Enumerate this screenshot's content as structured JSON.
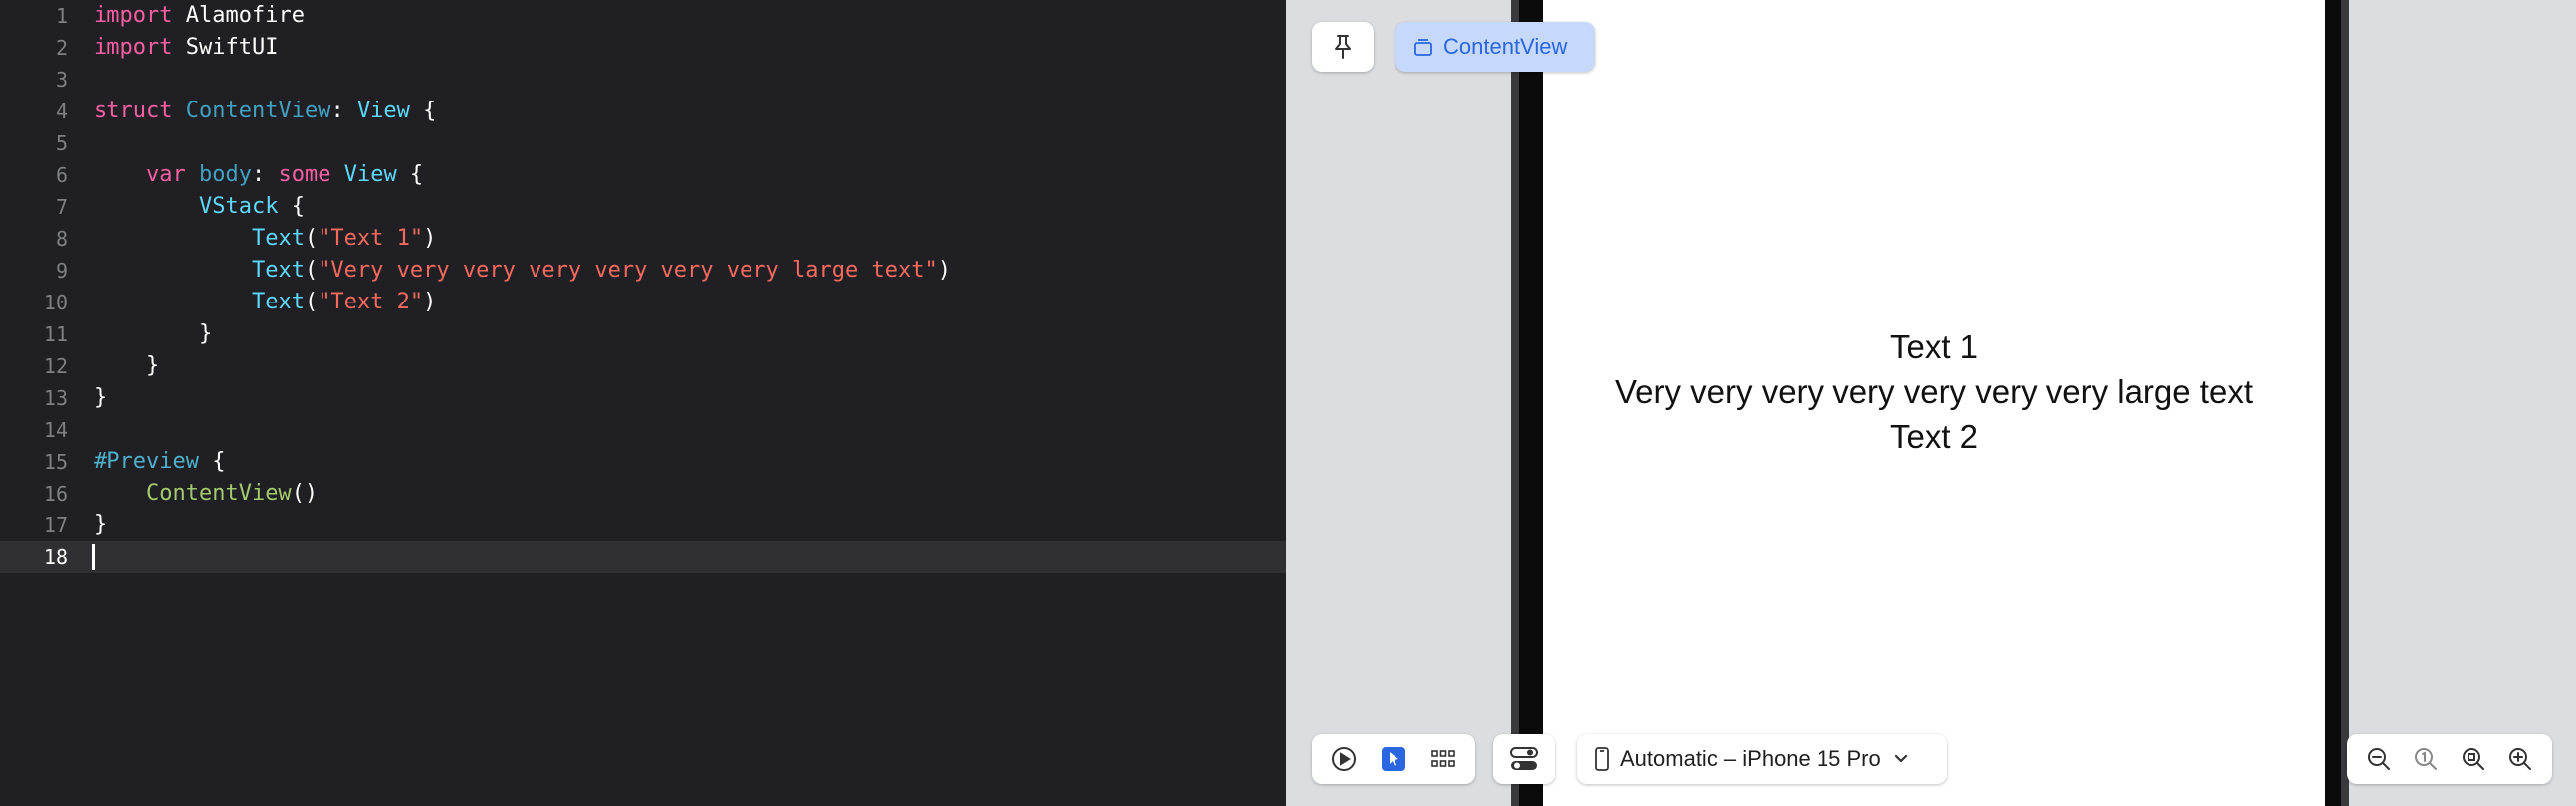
{
  "editor": {
    "current_line": 18,
    "lines": [
      {
        "n": "1",
        "tokens": [
          [
            "kw",
            "import"
          ],
          [
            "plain",
            " Alamofire"
          ]
        ]
      },
      {
        "n": "2",
        "tokens": [
          [
            "kw",
            "import"
          ],
          [
            "plain",
            " SwiftUI"
          ]
        ]
      },
      {
        "n": "3",
        "tokens": []
      },
      {
        "n": "4",
        "tokens": [
          [
            "kw",
            "struct"
          ],
          [
            "plain",
            " "
          ],
          [
            "decl",
            "ContentView"
          ],
          [
            "plain",
            ": "
          ],
          [
            "type",
            "View"
          ],
          [
            "plain",
            " {"
          ]
        ]
      },
      {
        "n": "5",
        "tokens": []
      },
      {
        "n": "6",
        "tokens": [
          [
            "plain",
            "    "
          ],
          [
            "kw",
            "var"
          ],
          [
            "plain",
            " "
          ],
          [
            "decl",
            "body"
          ],
          [
            "plain",
            ": "
          ],
          [
            "kw",
            "some"
          ],
          [
            "plain",
            " "
          ],
          [
            "type",
            "View"
          ],
          [
            "plain",
            " {"
          ]
        ]
      },
      {
        "n": "7",
        "tokens": [
          [
            "plain",
            "        "
          ],
          [
            "type",
            "VStack"
          ],
          [
            "plain",
            " {"
          ]
        ]
      },
      {
        "n": "8",
        "tokens": [
          [
            "plain",
            "            "
          ],
          [
            "type",
            "Text"
          ],
          [
            "plain",
            "("
          ],
          [
            "str",
            "\"Text 1\""
          ],
          [
            "plain",
            ")"
          ]
        ]
      },
      {
        "n": "9",
        "tokens": [
          [
            "plain",
            "            "
          ],
          [
            "type",
            "Text"
          ],
          [
            "plain",
            "("
          ],
          [
            "str",
            "\"Very very very very very very very large text\""
          ],
          [
            "plain",
            ")"
          ]
        ]
      },
      {
        "n": "10",
        "tokens": [
          [
            "plain",
            "            "
          ],
          [
            "type",
            "Text"
          ],
          [
            "plain",
            "("
          ],
          [
            "str",
            "\"Text 2\""
          ],
          [
            "plain",
            ")"
          ]
        ]
      },
      {
        "n": "11",
        "tokens": [
          [
            "plain",
            "        }"
          ]
        ]
      },
      {
        "n": "12",
        "tokens": [
          [
            "plain",
            "    }"
          ]
        ]
      },
      {
        "n": "13",
        "tokens": [
          [
            "plain",
            "}"
          ]
        ]
      },
      {
        "n": "14",
        "tokens": []
      },
      {
        "n": "15",
        "tokens": [
          [
            "macro",
            "#Preview"
          ],
          [
            "plain",
            " {"
          ]
        ]
      },
      {
        "n": "16",
        "tokens": [
          [
            "plain",
            "    "
          ],
          [
            "usr",
            "ContentView"
          ],
          [
            "plain",
            "()"
          ]
        ]
      },
      {
        "n": "17",
        "tokens": [
          [
            "plain",
            "}"
          ]
        ]
      },
      {
        "n": "18",
        "tokens": []
      }
    ]
  },
  "canvas": {
    "view_chip_label": "ContentView",
    "preview_lines": [
      "Text 1",
      "Very very very very very very very large text",
      "Text 2"
    ],
    "device_label": "Automatic – iPhone 15 Pro",
    "icons": {
      "pin": "pin-icon",
      "view": "view-stack-icon",
      "live": "play-icon",
      "selectable": "cursor-icon",
      "variants": "grid-icon",
      "settings": "device-settings-icon",
      "device": "iphone-icon",
      "chevron": "chevron-down-icon",
      "zoom_out": "zoom-out-icon",
      "zoom_100": "zoom-100-icon",
      "zoom_fit": "zoom-fit-icon",
      "zoom_in": "zoom-in-icon"
    },
    "accent_color": "#2a66e0"
  }
}
